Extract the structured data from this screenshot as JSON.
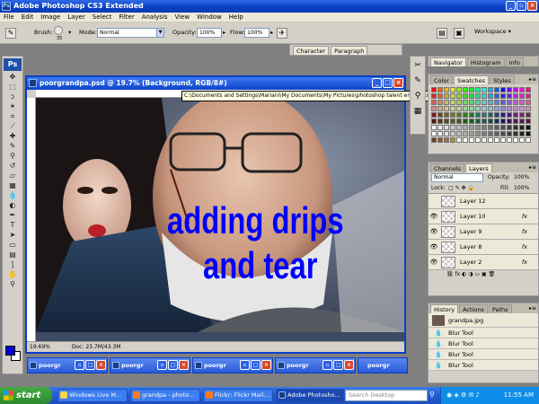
{
  "app": {
    "title": "Adobe Photoshop CS3 Extended",
    "logo": "Ps"
  },
  "menu": [
    "File",
    "Edit",
    "Image",
    "Layer",
    "Select",
    "Filter",
    "Analysis",
    "View",
    "Window",
    "Help"
  ],
  "options": {
    "brush_label": "Brush:",
    "brush_size": "35",
    "mode_label": "Mode:",
    "mode_value": "Normal",
    "opacity_label": "Opacity:",
    "opacity_value": "100%",
    "flow_label": "Flow:",
    "flow_value": "100%",
    "workspace_label": "Workspace ▾"
  },
  "char_panel": {
    "tabs": [
      "Character",
      "Paragraph"
    ]
  },
  "document": {
    "title": "poorgrandpa.psd @ 19.7% (Background, RGB/8#)",
    "path_tooltip": "C:\\Documents and Settings\\Mariani\\My Documents\\My Pictures\\photoshop talent entries\\poorgrandpa.psd @ 19.7% (Background, RGB/8#)",
    "zoom": "19.69%",
    "doc_size": "Doc: 23.7M/43.3M",
    "overlay_line1": "adding drips",
    "overlay_line2": "and tear"
  },
  "minimized_docs": [
    "poorgr",
    "poorgr",
    "poorgr",
    "poorgr",
    "poorgr"
  ],
  "navigator_panel": {
    "tabs": [
      "Navigator",
      "Histogram",
      "Info"
    ]
  },
  "swatches_panel": {
    "tabs": [
      "Color",
      "Swatches",
      "Styles"
    ]
  },
  "layers_panel": {
    "tabs": [
      "Channels",
      "Layers"
    ],
    "blend": "Normal",
    "opacity_label": "Opacity:",
    "opacity_value": "100%",
    "lock_label": "Lock:",
    "fill_label": "Fill:",
    "fill_value": "100%",
    "layers": [
      {
        "name": "Layer 12",
        "fx": "",
        "visible": false
      },
      {
        "name": "Layer 10",
        "fx": "fx",
        "visible": true
      },
      {
        "name": "Layer 9",
        "fx": "fx",
        "visible": true
      },
      {
        "name": "Layer 8",
        "fx": "fx",
        "visible": true
      },
      {
        "name": "Layer 2",
        "fx": "fx",
        "visible": true
      }
    ]
  },
  "history_panel": {
    "tabs": [
      "History",
      "Actions",
      "Paths"
    ],
    "snapshot": "grandpa.jpg",
    "items": [
      "Blur Tool",
      "Blur Tool",
      "Blur Tool",
      "Blur Tool"
    ]
  },
  "taskbar": {
    "start": "start",
    "items": [
      "Windows Live M...",
      "grandpa - photo...",
      "Flickr: Flickr Mail:...",
      "Adobe Photosho..."
    ],
    "search_placeholder": "Search Desktop",
    "clock": "11:55 AM"
  },
  "colors": {
    "foreground": "#0000d8",
    "background": "#ffffff",
    "overlay_text": "#0000ff",
    "title_blue": "#0a3fc4"
  }
}
